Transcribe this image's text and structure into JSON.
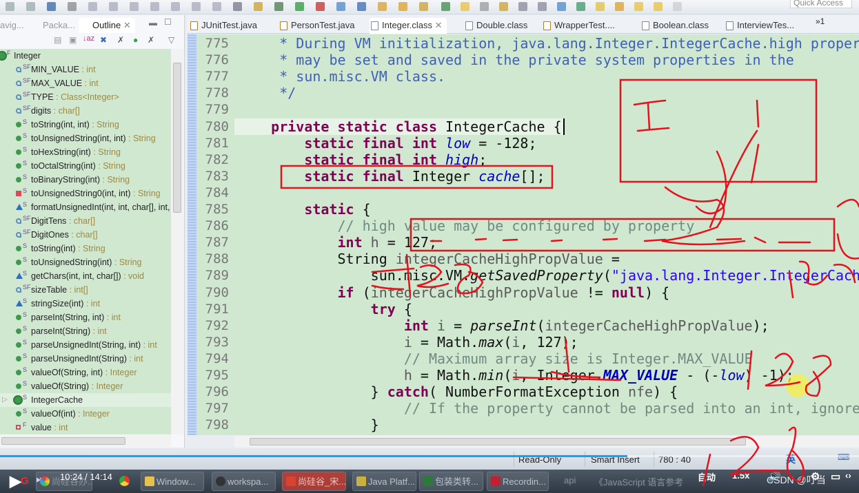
{
  "toolbar": {
    "quick_access": "Quick Access"
  },
  "left_panel": {
    "tabs": [
      {
        "label": "avig..."
      },
      {
        "label": "Packa..."
      },
      {
        "label": "Outline",
        "active": true
      }
    ],
    "tree": [
      {
        "mod": "F",
        "name": "Integer",
        "type": "",
        "icon": "class-icon"
      },
      {
        "mod": "SF",
        "name": "MIN_VALUE",
        "type": " : int",
        "icon": "constant-field-icon"
      },
      {
        "mod": "SF",
        "name": "MAX_VALUE",
        "type": " : int",
        "icon": "constant-field-icon"
      },
      {
        "mod": "SF",
        "name": "TYPE",
        "type": " : Class<Integer>",
        "icon": "constant-field-icon"
      },
      {
        "mod": "SF",
        "name": "digits",
        "type": " : char[]",
        "icon": "package-field-icon"
      },
      {
        "mod": "S",
        "name": "toString(int, int)",
        "type": " : String",
        "icon": "public-method-icon"
      },
      {
        "mod": "S",
        "name": "toUnsignedString(int, int)",
        "type": " : String",
        "icon": "public-method-icon"
      },
      {
        "mod": "S",
        "name": "toHexString(int)",
        "type": " : String",
        "icon": "public-method-icon"
      },
      {
        "mod": "S",
        "name": "toOctalString(int)",
        "type": " : String",
        "icon": "public-method-icon"
      },
      {
        "mod": "S",
        "name": "toBinaryString(int)",
        "type": " : String",
        "icon": "public-method-icon"
      },
      {
        "mod": "S",
        "name": "toUnsignedString0(int, int)",
        "type": " : String",
        "icon": "private-method-icon"
      },
      {
        "mod": "S",
        "name": "formatUnsignedInt(int, int, char[], int, int)",
        "type": "",
        "icon": "package-method-icon"
      },
      {
        "mod": "SF",
        "name": "DigitTens",
        "type": " : char[]",
        "icon": "package-field-icon"
      },
      {
        "mod": "SF",
        "name": "DigitOnes",
        "type": " : char[]",
        "icon": "package-field-icon"
      },
      {
        "mod": "S",
        "name": "toString(int)",
        "type": " : String",
        "icon": "public-method-icon"
      },
      {
        "mod": "S",
        "name": "toUnsignedString(int)",
        "type": " : String",
        "icon": "public-method-icon"
      },
      {
        "mod": "S",
        "name": "getChars(int, int, char[])",
        "type": " : void",
        "icon": "package-method-icon"
      },
      {
        "mod": "SF",
        "name": "sizeTable",
        "type": " : int[]",
        "icon": "package-field-icon"
      },
      {
        "mod": "S",
        "name": "stringSize(int)",
        "type": " : int",
        "icon": "package-method-icon"
      },
      {
        "mod": "S",
        "name": "parseInt(String, int)",
        "type": " : int",
        "icon": "public-method-icon"
      },
      {
        "mod": "S",
        "name": "parseInt(String)",
        "type": " : int",
        "icon": "public-method-icon"
      },
      {
        "mod": "S",
        "name": "parseUnsignedInt(String, int)",
        "type": " : int",
        "icon": "public-method-icon"
      },
      {
        "mod": "S",
        "name": "parseUnsignedInt(String)",
        "type": " : int",
        "icon": "public-method-icon"
      },
      {
        "mod": "S",
        "name": "valueOf(String, int)",
        "type": " : Integer",
        "icon": "public-method-icon"
      },
      {
        "mod": "S",
        "name": "valueOf(String)",
        "type": " : Integer",
        "icon": "public-method-icon"
      },
      {
        "mod": "S",
        "name": "IntegerCache",
        "type": "",
        "icon": "inner-class-icon",
        "expandable": true,
        "selected": true
      },
      {
        "mod": "S",
        "name": "valueOf(int)",
        "type": " : Integer",
        "icon": "public-method-icon"
      },
      {
        "mod": "F",
        "name": "value",
        "type": " : int",
        "icon": "private-field-icon"
      }
    ]
  },
  "editor": {
    "tabs": [
      {
        "label": "JUnitTest.java",
        "icon": "java-file-icon"
      },
      {
        "label": "PersonTest.java",
        "icon": "java-file-icon"
      },
      {
        "label": "Integer.class",
        "icon": "class-file-icon",
        "active": true
      },
      {
        "label": "Double.class",
        "icon": "class-file-icon"
      },
      {
        "label": "WrapperTest....",
        "icon": "java-file-icon"
      },
      {
        "label": "Boolean.class",
        "icon": "class-file-icon"
      },
      {
        "label": "InterviewTes...",
        "icon": "java-file-icon"
      }
    ],
    "overflow_label": "»1",
    "current_line": "780",
    "lines": [
      {
        "n": "775",
        "t": [
          [
            "     * During VM initialization, java.lang.Integer.IntegerCache.high property",
            "doc"
          ]
        ]
      },
      {
        "n": "776",
        "t": [
          [
            "     * may be set and saved in the private system properties in the",
            "doc"
          ]
        ]
      },
      {
        "n": "777",
        "t": [
          [
            "     * sun.misc.VM class.",
            "doc"
          ]
        ]
      },
      {
        "n": "778",
        "t": [
          [
            "     */",
            "doc"
          ]
        ]
      },
      {
        "n": "779",
        "t": []
      },
      {
        "n": "780",
        "t": [
          [
            "    ",
            ""
          ],
          [
            "private static class",
            "kw"
          ],
          [
            " IntegerCache {",
            ""
          ]
        ]
      },
      {
        "n": "781",
        "t": [
          [
            "        ",
            ""
          ],
          [
            "static final int",
            "kw"
          ],
          [
            " ",
            ""
          ],
          [
            "low",
            "fld"
          ],
          [
            " = -128;",
            ""
          ]
        ]
      },
      {
        "n": "782",
        "t": [
          [
            "        ",
            ""
          ],
          [
            "static final int",
            "kw"
          ],
          [
            " ",
            ""
          ],
          [
            "high",
            "fld"
          ],
          [
            ";",
            ""
          ]
        ]
      },
      {
        "n": "783",
        "t": [
          [
            "        ",
            ""
          ],
          [
            "static final",
            "kw"
          ],
          [
            " Integer ",
            ""
          ],
          [
            "cache",
            "fld"
          ],
          [
            "[];",
            ""
          ]
        ]
      },
      {
        "n": "784",
        "t": []
      },
      {
        "n": "785",
        "t": [
          [
            "        ",
            ""
          ],
          [
            "static",
            "kw"
          ],
          [
            " {",
            ""
          ]
        ]
      },
      {
        "n": "786",
        "t": [
          [
            "            // high value may be configured by property",
            "cm"
          ]
        ]
      },
      {
        "n": "787",
        "t": [
          [
            "            ",
            ""
          ],
          [
            "int",
            "kw"
          ],
          [
            " ",
            ""
          ],
          [
            "h",
            "var"
          ],
          [
            " = 127;",
            ""
          ]
        ]
      },
      {
        "n": "788",
        "t": [
          [
            "            String ",
            ""
          ],
          [
            "integerCacheHighPropValue",
            "var"
          ],
          [
            " =",
            ""
          ]
        ]
      },
      {
        "n": "789",
        "t": [
          [
            "                sun.misc.VM.",
            ""
          ],
          [
            "getSavedProperty",
            "it"
          ],
          [
            "(",
            ""
          ],
          [
            "\"java.lang.Integer.IntegerCache.high\"",
            "str"
          ],
          [
            ");",
            ""
          ]
        ]
      },
      {
        "n": "790",
        "t": [
          [
            "            ",
            ""
          ],
          [
            "if",
            "kw"
          ],
          [
            " (",
            ""
          ],
          [
            "integerCacheHighPropValue",
            "var"
          ],
          [
            " != ",
            ""
          ],
          [
            "null",
            "kw"
          ],
          [
            ") {",
            ""
          ]
        ]
      },
      {
        "n": "791",
        "t": [
          [
            "                ",
            ""
          ],
          [
            "try",
            "kw"
          ],
          [
            " {",
            ""
          ]
        ]
      },
      {
        "n": "792",
        "t": [
          [
            "                    ",
            ""
          ],
          [
            "int",
            "kw"
          ],
          [
            " ",
            ""
          ],
          [
            "i",
            "var"
          ],
          [
            " = ",
            ""
          ],
          [
            "parseInt",
            "it"
          ],
          [
            "(",
            ""
          ],
          [
            "integerCacheHighPropValue",
            "var"
          ],
          [
            ");",
            ""
          ]
        ]
      },
      {
        "n": "793",
        "t": [
          [
            "                    ",
            ""
          ],
          [
            "i",
            "var"
          ],
          [
            " = Math.",
            ""
          ],
          [
            "max",
            "it"
          ],
          [
            "(",
            ""
          ],
          [
            "i",
            "var"
          ],
          [
            ", 127);",
            ""
          ]
        ]
      },
      {
        "n": "794",
        "t": [
          [
            "                    // Maximum array size is Integer.MAX_VALUE",
            "cm"
          ]
        ]
      },
      {
        "n": "795",
        "t": [
          [
            "                    ",
            ""
          ],
          [
            "h",
            "var"
          ],
          [
            " = Math.",
            ""
          ],
          [
            "min",
            "it"
          ],
          [
            "(",
            ""
          ],
          [
            "i",
            "var"
          ],
          [
            ", Integer.",
            ""
          ],
          [
            "MAX_VALUE",
            "sfld"
          ],
          [
            " - (-",
            ""
          ],
          [
            "low",
            "fld"
          ],
          [
            ") -1);",
            ""
          ]
        ]
      },
      {
        "n": "796",
        "t": [
          [
            "                } ",
            ""
          ],
          [
            "catch",
            "kw"
          ],
          [
            "( NumberFormatException ",
            ""
          ],
          [
            "nfe",
            "var"
          ],
          [
            ") {",
            ""
          ]
        ]
      },
      {
        "n": "797",
        "t": [
          [
            "                    // If the property cannot be parsed into an int, ignore it.",
            "cm"
          ]
        ]
      },
      {
        "n": "798",
        "t": [
          [
            "                }",
            ""
          ]
        ]
      }
    ]
  },
  "status": {
    "read_only": "Read-Only",
    "insert_mode": "Smart Insert",
    "position": "780 : 40"
  },
  "video": {
    "time": "10:24 / 14:14",
    "progress_percent": 73,
    "speed": "1.5x",
    "quality": "自动",
    "watermark": "CSDN @叮当"
  },
  "taskbar": {
    "items": [
      "尚硅谷办...",
      "Window...",
      "workspa...",
      "尚硅谷_宋...",
      "Java Platf...",
      "包装类转...",
      "Recordin..."
    ],
    "extra": [
      "api",
      "《JavaScript 语言参考"
    ],
    "ime": "英"
  },
  "colors": {
    "editor_bg": "#cfe8cf",
    "keyword": "#7f0055",
    "javadoc": "#3f5fbf",
    "field": "#0000c0",
    "string": "#2a00ff",
    "annotation_red": "#e8101a",
    "progress": "#1aa0e6"
  }
}
